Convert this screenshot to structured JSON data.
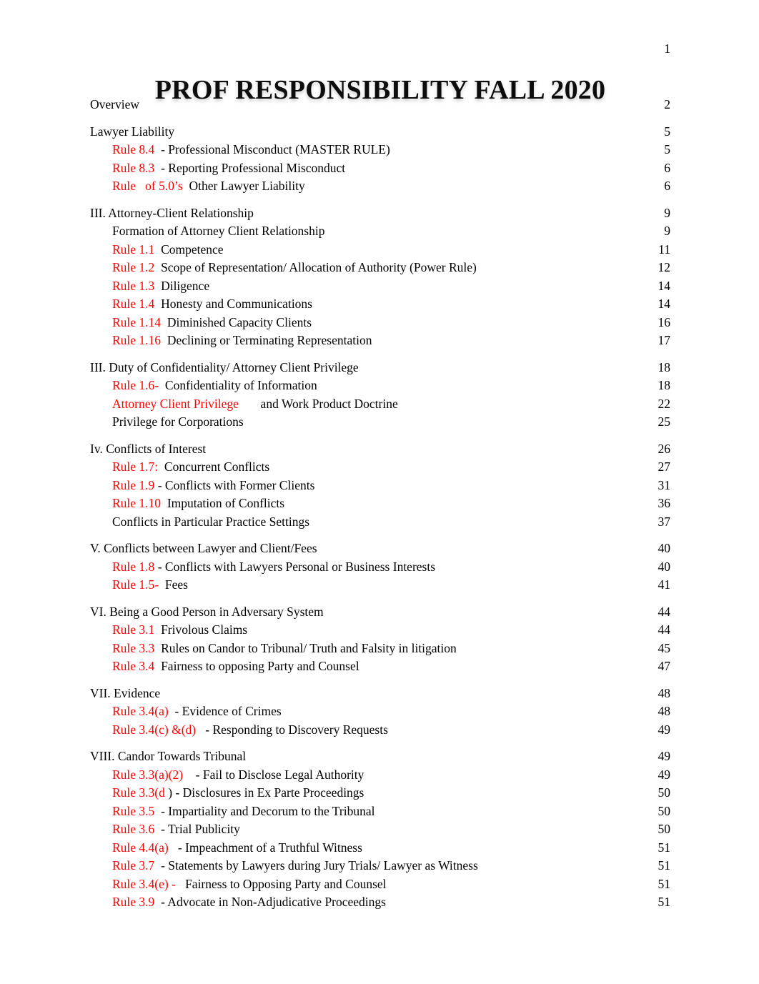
{
  "document": {
    "header_page_number": "1",
    "title": "PROF RESPONSIBILITY FALL 2020",
    "accent_color": "#ff0000",
    "text_color": "#000000"
  },
  "toc": {
    "entries": [
      {
        "level": 1,
        "rule": "",
        "text": "Overview",
        "page": "2"
      },
      {
        "level": 1,
        "rule": "",
        "text": "Lawyer Liability",
        "page": "5"
      },
      {
        "level": 2,
        "rule": "Rule 8.4",
        "text": "  - Professional Misconduct (MASTER RULE)",
        "page": "5"
      },
      {
        "level": 2,
        "rule": "Rule 8.3",
        "text": "  - Reporting Professional Misconduct",
        "page": "6"
      },
      {
        "level": 2,
        "rule": "Rule   of 5.0’s",
        "text": "  Other Lawyer Liability",
        "page": "6"
      },
      {
        "level": 1,
        "rule": "",
        "text": "III. Attorney-Client Relationship",
        "page": "9"
      },
      {
        "level": 2,
        "rule": "",
        "text": "Formation of Attorney Client Relationship",
        "page": "9"
      },
      {
        "level": 2,
        "rule": "Rule 1.1",
        "text": "  Competence",
        "page": "11"
      },
      {
        "level": 2,
        "rule": "Rule 1.2",
        "text": "  Scope of Representation/ Allocation of Authority (Power Rule)",
        "page": "12"
      },
      {
        "level": 2,
        "rule": "Rule 1.3",
        "text": "  Diligence",
        "page": "14"
      },
      {
        "level": 2,
        "rule": "Rule 1.4",
        "text": "  Honesty and Communications",
        "page": "14"
      },
      {
        "level": 2,
        "rule": "Rule 1.14",
        "text": "  Diminished Capacity Clients",
        "page": "16"
      },
      {
        "level": 2,
        "rule": "Rule 1.16",
        "text": "  Declining or Terminating Representation",
        "page": "17"
      },
      {
        "level": 1,
        "rule": "",
        "text": "III. Duty of Confidentiality/ Attorney Client Privilege",
        "page": "18"
      },
      {
        "level": 2,
        "rule": "Rule 1.6-",
        "text": "  Confidentiality of Information",
        "page": "18"
      },
      {
        "level": 2,
        "rule": "Attorney Client Privilege",
        "text": "       and Work Product Doctrine",
        "page": "22"
      },
      {
        "level": 2,
        "rule": "",
        "text": "Privilege for Corporations",
        "page": "25"
      },
      {
        "level": 1,
        "rule": "",
        "text": "Iv. Conflicts of Interest",
        "page": "26"
      },
      {
        "level": 2,
        "rule": "Rule 1.7:",
        "text": "  Concurrent Conflicts",
        "page": "27"
      },
      {
        "level": 2,
        "rule": "Rule 1.9",
        "text": " - Conflicts with Former Clients",
        "page": "31"
      },
      {
        "level": 2,
        "rule": "Rule 1.10",
        "text": "  Imputation of Conflicts",
        "page": "36"
      },
      {
        "level": 2,
        "rule": "",
        "text": "Conflicts in Particular Practice Settings",
        "page": "37"
      },
      {
        "level": 1,
        "rule": "",
        "text": "V. Conflicts between Lawyer and Client/Fees",
        "page": "40"
      },
      {
        "level": 2,
        "rule": "Rule 1.8",
        "text": " - Conflicts with Lawyers Personal or Business Interests",
        "page": "40"
      },
      {
        "level": 2,
        "rule": "Rule 1.5-",
        "text": "  Fees",
        "page": "41"
      },
      {
        "level": 1,
        "rule": "",
        "text": "VI. Being a Good Person in Adversary System",
        "page": "44"
      },
      {
        "level": 2,
        "rule": "Rule 3.1",
        "text": "  Frivolous Claims",
        "page": "44"
      },
      {
        "level": 2,
        "rule": "Rule 3.3",
        "text": "  Rules on Candor to Tribunal/ Truth and Falsity in litigation",
        "page": "45"
      },
      {
        "level": 2,
        "rule": "Rule 3.4",
        "text": "  Fairness to opposing Party and Counsel",
        "page": "47"
      },
      {
        "level": 1,
        "rule": "",
        "text": "VII. Evidence",
        "page": "48"
      },
      {
        "level": 2,
        "rule": "Rule 3.4(a)",
        "text": "  - Evidence of Crimes",
        "page": "48"
      },
      {
        "level": 2,
        "rule": "Rule 3.4(c) &(d)",
        "text": "   - Responding to Discovery Requests",
        "page": "49"
      },
      {
        "level": 1,
        "rule": "",
        "text": "VIII. Candor Towards Tribunal",
        "page": "49"
      },
      {
        "level": 2,
        "rule": "Rule 3.3(a)(2)",
        "text": "    - Fail to Disclose Legal Authority",
        "page": "49"
      },
      {
        "level": 2,
        "rule": "Rule 3.3(d",
        "text": " ) - Disclosures in Ex Parte Proceedings",
        "page": "50"
      },
      {
        "level": 2,
        "rule": "Rule 3.5",
        "text": "  - Impartiality and Decorum to the Tribunal",
        "page": "50"
      },
      {
        "level": 2,
        "rule": "Rule 3.6",
        "text": "  - Trial Publicity",
        "page": "50"
      },
      {
        "level": 2,
        "rule": "Rule 4.4(a)",
        "text": "   - Impeachment of a Truthful Witness",
        "page": "51"
      },
      {
        "level": 2,
        "rule": "Rule 3.7",
        "text": "  - Statements by Lawyers during Jury Trials/ Lawyer as Witness",
        "page": "51"
      },
      {
        "level": 2,
        "rule": "Rule 3.4(e) -",
        "text": "   Fairness to Opposing Party and Counsel",
        "page": "51"
      },
      {
        "level": 2,
        "rule": "Rule 3.9",
        "text": "  - Advocate in Non-Adjudicative Proceedings",
        "page": "51"
      }
    ]
  }
}
